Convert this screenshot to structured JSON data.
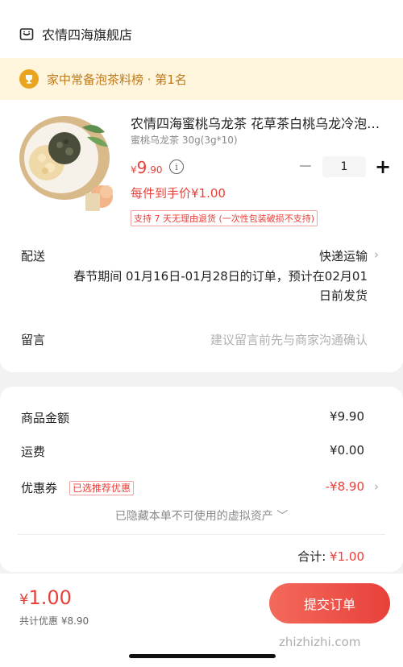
{
  "shop": {
    "name": "农情四海旗舰店",
    "icon": "shop-icon"
  },
  "ranking": {
    "text": "家中常备泡茶料榜 · 第1名",
    "icon": "trophy-icon"
  },
  "product": {
    "title": "农情四海蜜桃乌龙茶 花草茶白桃乌龙冷泡茶包",
    "spec": "蜜桃乌龙茶 30g(3g*10)",
    "price_symbol": "¥",
    "price_main": "9",
    "price_decimal": ".90",
    "info_glyph": "i",
    "quantity": "1",
    "minus_glyph": "−",
    "plus_glyph": "+",
    "unit_price_text": "每件到手价¥1.00",
    "return_policy": "支持 7 天无理由退货 (一次性包装破损不支持)"
  },
  "delivery": {
    "label": "配送",
    "method": "快递运输",
    "note": "春节期间 01月16日-01月28日的订单，预计在02月01日前发货"
  },
  "remark": {
    "label": "留言",
    "placeholder": "建议留言前先与商家沟通确认"
  },
  "fees": {
    "goods_label": "商品金额",
    "goods_value": "¥9.90",
    "shipping_label": "运费",
    "shipping_value": "¥0.00",
    "coupon_label": "优惠券",
    "coupon_badge": "已选推荐优惠",
    "coupon_value": "-¥8.90",
    "hidden_note": "已隐藏本单不可使用的虚拟资产 ﹀",
    "subtotal_label": "合计: ",
    "subtotal_value": "¥1.00"
  },
  "footer": {
    "total_symbol": "¥",
    "total_main": "1.00",
    "total_discount": "共计优惠 ¥8.90",
    "submit_label": "提交订单"
  },
  "chevron_glyph": "›",
  "watermark": "zhizhizhi.com",
  "colors": {
    "accent": "#e8403b",
    "rank_bg": "#fff5dc",
    "rank_text": "#c07a1a"
  }
}
